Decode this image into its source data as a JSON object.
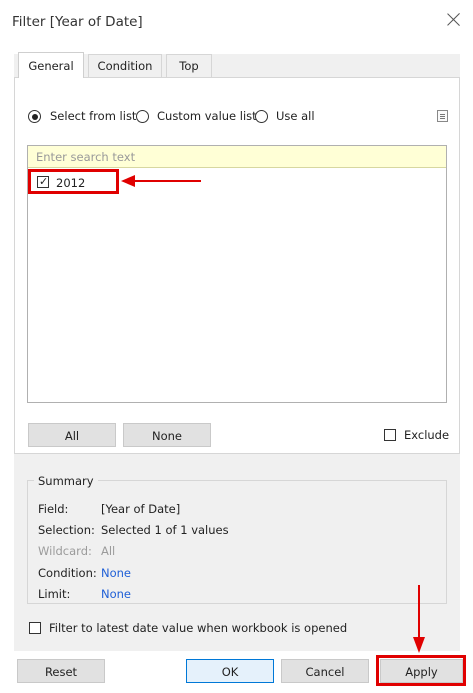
{
  "window": {
    "title": "Filter [Year of Date]"
  },
  "tabs": [
    {
      "label": "General",
      "active": true
    },
    {
      "label": "Condition",
      "active": false
    },
    {
      "label": "Top",
      "active": false
    }
  ],
  "mode": {
    "options": [
      {
        "label": "Select from list",
        "selected": true
      },
      {
        "label": "Custom value list",
        "selected": false
      },
      {
        "label": "Use all",
        "selected": false
      }
    ]
  },
  "search": {
    "placeholder": "Enter search text"
  },
  "list": {
    "items": [
      {
        "label": "2012",
        "checked": true
      }
    ]
  },
  "buttons": {
    "all": "All",
    "none": "None"
  },
  "exclude": {
    "label": "Exclude",
    "checked": false
  },
  "summary": {
    "title": "Summary",
    "rows": [
      {
        "key": "Field:",
        "value": "[Year of Date]"
      },
      {
        "key": "Selection:",
        "value": "Selected 1 of 1 values"
      },
      {
        "key": "Wildcard:",
        "value": "All"
      },
      {
        "key": "Condition:",
        "value": "None"
      },
      {
        "key": "Limit:",
        "value": "None"
      }
    ]
  },
  "latest_date": {
    "label": "Filter to latest date value when workbook is opened",
    "checked": false
  },
  "footer": {
    "reset": "Reset",
    "ok": "OK",
    "cancel": "Cancel",
    "apply": "Apply"
  },
  "colors": {
    "highlight": "#e00000",
    "link": "#1f5fd6",
    "search_bg": "#ffffd6"
  }
}
